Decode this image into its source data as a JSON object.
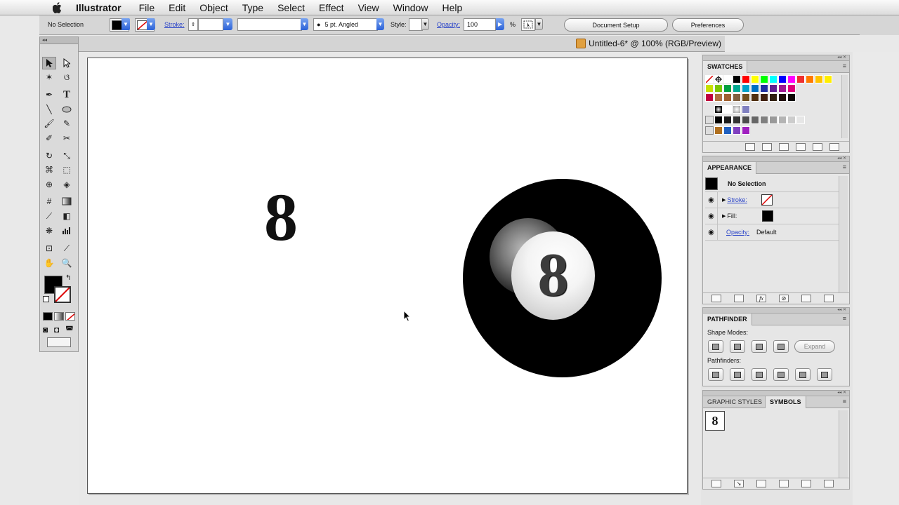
{
  "menubar": {
    "app": "Illustrator",
    "items": [
      "File",
      "Edit",
      "Object",
      "Type",
      "Select",
      "Effect",
      "View",
      "Window",
      "Help"
    ]
  },
  "control": {
    "selection": "No Selection",
    "stroke_label": "Stroke:",
    "brush": "5 pt. Angled",
    "style_label": "Style:",
    "opacity_label": "Opacity:",
    "opacity_value": "100",
    "percent": "%",
    "document_setup": "Document Setup",
    "preferences": "Preferences"
  },
  "document": {
    "title": "Untitled-6* @ 100% (RGB/Preview)"
  },
  "canvas": {
    "big_eight": "8",
    "ball_number": "8"
  },
  "swatches": {
    "title": "SWATCHES",
    "colors": [
      [
        "#ff0000",
        "#ffff00",
        "#00ff00",
        "#00ffff",
        "#0000ff",
        "#ff00ff",
        "#ee3030",
        "#ff7a00",
        "#ffc400",
        "#ffee00"
      ],
      [
        "#c8e000",
        "#7ac800",
        "#00a040",
        "#00a890",
        "#00a0c8",
        "#0070c0",
        "#2030a0",
        "#602090",
        "#a01890",
        "#e0007a"
      ],
      [
        "#c00040",
        "#b07040",
        "#a06030",
        "#806040",
        "#705020",
        "#503010",
        "#402010",
        "#302010",
        "#201008",
        "#100804"
      ]
    ],
    "grays": [
      "#000000",
      "#1a1a1a",
      "#333333",
      "#4d4d4d",
      "#666666",
      "#808080",
      "#999999",
      "#b3b3b3",
      "#cccccc",
      "#e6e6e6"
    ],
    "extra": [
      "#b07020",
      "#2060c0",
      "#8040c0",
      "#a020c0"
    ]
  },
  "appearance": {
    "title": "APPEARANCE",
    "header": "No Selection",
    "stroke_label": "Stroke:",
    "fill_label": "Fill:",
    "opacity_label": "Opacity:",
    "opacity_value": "Default"
  },
  "pathfinder": {
    "title": "PATHFINDER",
    "shape_modes": "Shape Modes:",
    "expand": "Expand",
    "pathfinders": "Pathfinders:"
  },
  "symbols": {
    "tab_graphic_styles": "GRAPHIC STYLES",
    "tab_symbols": "SYMBOLS",
    "symbol_eight": "8"
  },
  "icons": {
    "menu": "≡",
    "eye": "◉",
    "triangle": "▶"
  }
}
